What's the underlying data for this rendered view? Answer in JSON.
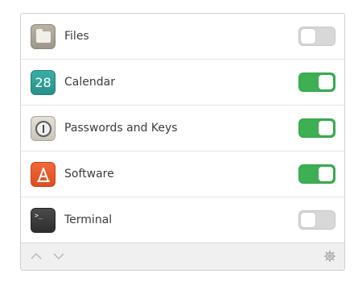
{
  "apps": [
    {
      "name": "Files",
      "icon": "files-icon",
      "enabled": false
    },
    {
      "name": "Calendar",
      "icon": "calendar-icon",
      "icon_text": "28",
      "enabled": true
    },
    {
      "name": "Passwords and Keys",
      "icon": "passwords-keys-icon",
      "enabled": true
    },
    {
      "name": "Software",
      "icon": "software-icon",
      "enabled": true
    },
    {
      "name": "Terminal",
      "icon": "terminal-icon",
      "icon_text": ">_",
      "enabled": false
    }
  ],
  "footer": {
    "up_icon": "chevron-up-icon",
    "down_icon": "chevron-down-icon",
    "settings_icon": "gear-icon"
  },
  "colors": {
    "toggle_on": "#3cb052",
    "toggle_off": "#d8d8d8",
    "calendar": "#2ea59d",
    "software": "#e95a2c",
    "terminal": "#3a3a3a"
  }
}
